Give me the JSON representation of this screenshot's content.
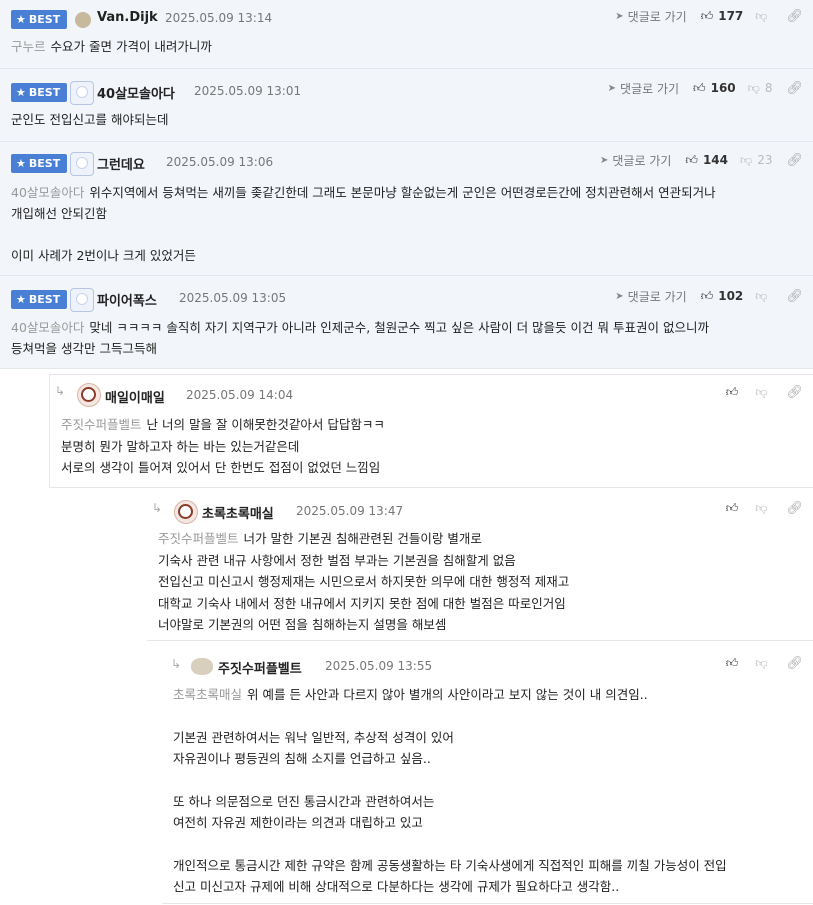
{
  "comments": [
    {
      "badge": "BEST",
      "nick": "Van.Dijk",
      "date": "2025.05.09 13:14",
      "reply_label": "댓글로 가기",
      "likes": "177",
      "dislikes": "",
      "mention": "구누르",
      "lines": [
        "수요가 줄면 가격이 내려가니까"
      ]
    },
    {
      "badge": "BEST",
      "nick": "40살모솔아다",
      "date": "2025.05.09 13:01",
      "reply_label": "댓글로 가기",
      "likes": "160",
      "dislikes": "8",
      "mention": "",
      "lines": [
        "군인도 전입신고를 해야되는데"
      ]
    },
    {
      "badge": "BEST",
      "nick": "그런데요",
      "date": "2025.05.09 13:06",
      "reply_label": "댓글로 가기",
      "likes": "144",
      "dislikes": "23",
      "mention": "40살모솔아다",
      "lines": [
        "위수지역에서 등쳐먹는 새끼들 좆같긴한데 그래도 본문마냥 할순없는게 군인은 어떤경로든간에 정치관련해서 연관되거나",
        "개입해선 안되긴함",
        "",
        "이미 사례가 2번이나 크게 있었거든"
      ]
    },
    {
      "badge": "BEST",
      "nick": "파이어폭스",
      "date": "2025.05.09 13:05",
      "reply_label": "댓글로 가기",
      "likes": "102",
      "dislikes": "",
      "mention": "40살모솔아다",
      "lines": [
        "맞네 ㅋㅋㅋㅋ 솔직히 자기 지역구가 아니라 인제군수, 철원군수 찍고 싶은 사람이 더 많을듯 이건 뭐 투표권이 없으니까",
        "등쳐먹을 생각만 그득그득해"
      ]
    }
  ],
  "replies": [
    {
      "nick": "매일이매일",
      "date": "2025.05.09 14:04",
      "mention": "주짓수퍼플벨트",
      "lines": [
        "난 너의 말을 잘 이해못한것같아서 답답함ㅋㅋ",
        "분명히 뭔가 말하고자 하는 바는 있는거같은데",
        "서로의 생각이 틀어져 있어서 단 한번도 접점이 없었던 느낌임"
      ]
    },
    {
      "nick": "초록초록매실",
      "date": "2025.05.09 13:47",
      "mention": "주짓수퍼플벨트",
      "lines": [
        "너가 말한 기본권 침해관련된 건들이랑 별개로",
        "기숙사 관련 내규 사항에서 정한 벌점 부과는 기본권을 침해할게 없음",
        "전입신고 미신고시 행정제재는 시민으로서 하지못한 의무에 대한 행정적 제재고",
        "대학교 기숙사 내에서 정한 내규에서 지키지 못한 점에 대한 벌점은 따로인거임",
        "너야말로 기본권의 어떤 점을 침해하는지 설명을 해보셈"
      ]
    },
    {
      "nick": "주짓수퍼플벨트",
      "date": "2025.05.09 13:55",
      "mention": "초록초록매실",
      "lines": [
        "위 예를 든 사안과 다르지 않아 별개의 사안이라고 보지 않는 것이 내 의견임..",
        "",
        "기본권 관련하여서는 워낙 일반적, 추상적 성격이 있어",
        "자유권이나 평등권의 침해 소지를 언급하고 싶음..",
        "",
        "또 하나 의문점으로 던진 통금시간과 관련하여서는",
        "여전히 자유권 제한이라는 의견과 대립하고 있고",
        "",
        "개인적으로 통금시간 제한 규약은 함께 공동생활하는 타 기숙사생에게 직접적인 피해를 끼칠 가능성이 전입",
        "신고 미신고자 규제에 비해 상대적으로 다분하다는 생각에 규제가 필요하다고 생각함.."
      ]
    }
  ],
  "icons": {
    "star": "star-icon",
    "plane": "paper-plane-icon",
    "thumb_up": "thumbs-up-icon",
    "thumb_down": "thumbs-down-icon",
    "link": "link-icon",
    "reply": "reply-arrow-icon"
  },
  "colors": {
    "badge": "#4a7fd6",
    "best_bg": "#f2f5fa",
    "mention": "#999999"
  }
}
